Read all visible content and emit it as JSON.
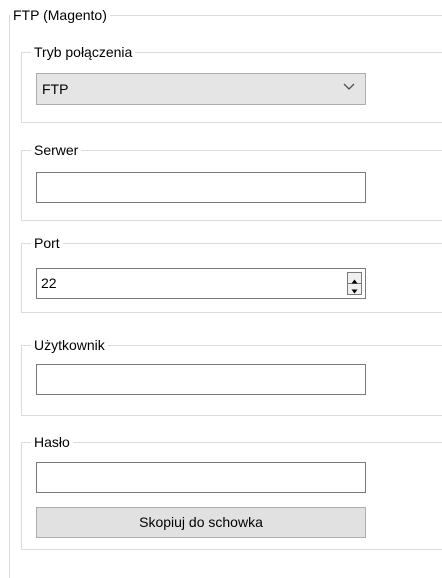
{
  "outer_group": {
    "title": "FTP (Magento)"
  },
  "connection_mode": {
    "title": "Tryb połączenia",
    "selected": "FTP",
    "icon": "chevron-down-icon"
  },
  "server": {
    "title": "Serwer",
    "value": ""
  },
  "port": {
    "title": "Port",
    "value": "22",
    "icons": [
      "spin-up-icon",
      "spin-down-icon"
    ]
  },
  "user": {
    "title": "Użytkownik",
    "value": ""
  },
  "password": {
    "title": "Hasło",
    "value": "",
    "copy_button_label": "Skopiuj do schowka"
  }
}
